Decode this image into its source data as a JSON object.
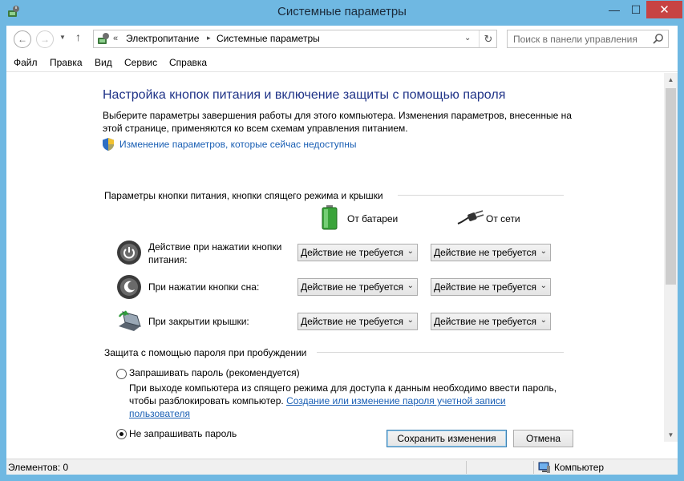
{
  "window": {
    "title": "Системные параметры",
    "minimize_glyph": "—",
    "maximize_glyph": "☐",
    "close_glyph": "✕"
  },
  "navigation": {
    "back_glyph": "←",
    "forward_glyph": "→",
    "recent_glyph": "▼",
    "up_glyph": "↑",
    "breadcrumb_overflow": "«",
    "breadcrumb": [
      "Электропитание",
      "Системные параметры"
    ],
    "separator_glyph": "▸",
    "dropdown_glyph": "⌄",
    "refresh_glyph": "↻",
    "search_placeholder": "Поиск в панели управления"
  },
  "menu": {
    "items": [
      "Файл",
      "Правка",
      "Вид",
      "Сервис",
      "Справка"
    ]
  },
  "page": {
    "heading": "Настройка кнопок питания и включение защиты с помощью пароля",
    "description": "Выберите параметры завершения работы для этого компьютера. Изменения параметров, внесенные на этой странице, применяются ко всем схемам управления питанием.",
    "change_link": "Изменение параметров, которые сейчас недоступны",
    "buttons_section_title": "Параметры кнопки питания, кнопки спящего режима и крышки",
    "col_battery": "От батареи",
    "col_ac": "От сети",
    "rows": [
      {
        "label": "Действие при нажатии кнопки питания:",
        "battery": "Действие не требуется",
        "ac": "Действие не требуется"
      },
      {
        "label": "При нажатии кнопки сна:",
        "battery": "Действие не требуется",
        "ac": "Действие не требуется"
      },
      {
        "label": "При закрытии крышки:",
        "battery": "Действие не требуется",
        "ac": "Действие не требуется"
      }
    ],
    "select_chevron": "⌄",
    "password_section_title": "Защита с помощью пароля при пробуждении",
    "option_require": "Запрашивать пароль (рекомендуется)",
    "option_require_desc": "При выходе компьютера из спящего режима для доступа к данным необходимо ввести пароль, чтобы разблокировать компьютер.",
    "option_require_link": "Создание или изменение пароля учетной записи пользователя",
    "option_require_selected": false,
    "option_no_password": "Не запрашивать пароль",
    "option_no_password_selected": true
  },
  "scrollbar": {
    "up_glyph": "▲",
    "down_glyph": "▼"
  },
  "footer": {
    "save_label": "Сохранить изменения",
    "cancel_label": "Отмена"
  },
  "status": {
    "items_count": "Элементов: 0",
    "location": "Компьютер"
  }
}
